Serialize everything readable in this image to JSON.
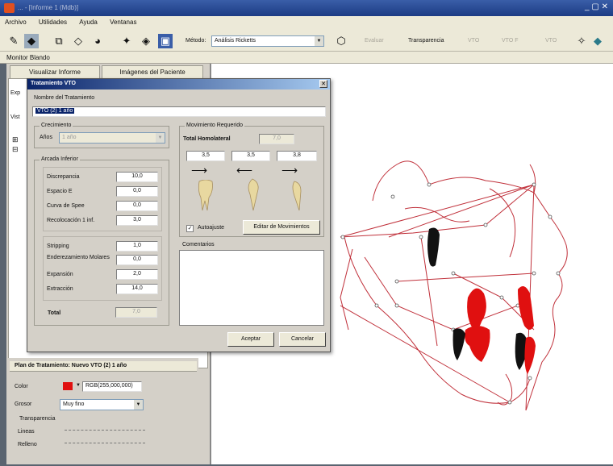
{
  "app": {
    "title": "... - [Informe 1 (Mdb)]"
  },
  "menu": [
    "Archivo",
    "Utilidades",
    "Ayuda",
    "Ventanas"
  ],
  "toolbar": {
    "metodo_label": "Método:",
    "metodo_value": "Análisis Ricketts",
    "mover_label": "Evaluar",
    "transparencia_label": "Transparencia",
    "vto_label": "VTO",
    "btn_a": "VTO F",
    "btn_b": "VTO"
  },
  "monitor": {
    "label": "Monitor Blando"
  },
  "tabs": [
    "Visualizar Informe",
    "Imágenes del Paciente"
  ],
  "dialog": {
    "title": "Tratamiento VTO",
    "nombre_label": "Nombre del Tratamiento",
    "nombre_value": "VTO (2) 1 año",
    "crecimiento": {
      "title": "Crecimiento",
      "anos_label": "Años",
      "anos_value": "1 año"
    },
    "arcada": {
      "title": "Arcada Inferior",
      "rows": [
        {
          "label": "Discrepancia",
          "value": "10,0"
        },
        {
          "label": "Espacio E",
          "value": "0,0"
        },
        {
          "label": "Curva de Spee",
          "value": "0,0"
        },
        {
          "label": "Recolocación 1 inf.",
          "value": "3,0"
        }
      ],
      "rows2": [
        {
          "label": "Stripping",
          "value": "1,0"
        },
        {
          "label": "Enderezamiento Molares",
          "value": "0,0"
        },
        {
          "label": "Expansión",
          "value": "2,0"
        },
        {
          "label": "Extracción",
          "value": "14,0"
        }
      ],
      "total_label": "Total",
      "total_value": "7,0"
    },
    "movimientos": {
      "title": "Movimiento Requerido",
      "total_label": "Total Homolateral",
      "total_value": "7,0",
      "values": [
        "3,5",
        "3,5",
        "3,8"
      ],
      "autoajuste_label": "Autoajuste",
      "autoajuste_checked": true,
      "editar_label": "Editar de Movimientos"
    },
    "comentarios_label": "Comentarios",
    "aceptar": "Aceptar",
    "cancelar": "Cancelar"
  },
  "plan": {
    "header": "Plan de Tratamiento: Nuevo VTO (2) 1 año",
    "color_label": "Color",
    "color_value": "RGB(255,000,000)",
    "color_hex": "#e01010",
    "grosor_label": "Grosor",
    "grosor_value": "Muy fino",
    "transparencia_label": "Transparencia",
    "lineas_label": "Lineas",
    "relleno_label": "Relleno"
  },
  "leftpane_labels": [
    "Exp",
    "Vist"
  ],
  "colors": {
    "accent_red": "#e01010",
    "line_red": "#c0303a",
    "title_blue": "#0a246a"
  }
}
